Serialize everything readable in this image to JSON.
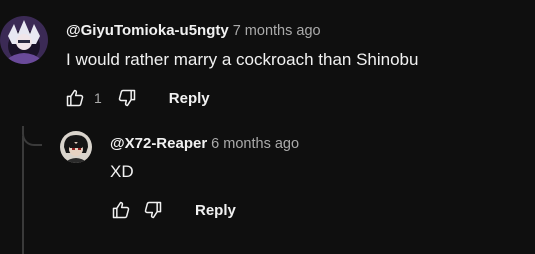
{
  "comment": {
    "author": "@GiyuTomioka-u5ngty",
    "time": "7 months ago",
    "text": "I would rather marry a cockroach than Shinobu",
    "like_count": "1",
    "reply_label": "Reply",
    "avatar_icon": "user-avatar-icon",
    "like_icon": "thumbs-up-icon",
    "dislike_icon": "thumbs-down-icon"
  },
  "reply": {
    "author": "@X72-Reaper",
    "time": "6 months ago",
    "text": "XD",
    "reply_label": "Reply",
    "avatar_icon": "user-avatar-icon",
    "like_icon": "thumbs-up-icon",
    "dislike_icon": "thumbs-down-icon"
  },
  "colors": {
    "background": "#0f0f0f",
    "primary_text": "#f1f1f1",
    "secondary_text": "#aaaaaa",
    "thread_line": "#3a3a3a"
  }
}
